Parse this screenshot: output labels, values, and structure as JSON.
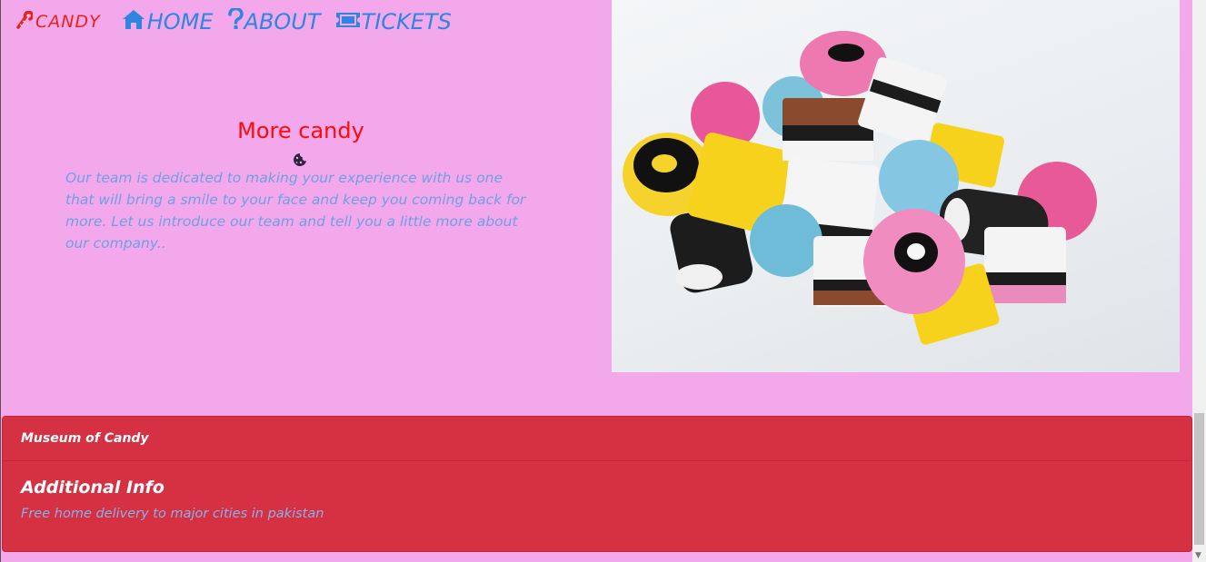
{
  "nav": {
    "brand": "CANDY",
    "links": [
      {
        "label": "HOME",
        "icon": "home-icon"
      },
      {
        "label": "ABOUT",
        "icon": "question-icon"
      },
      {
        "label": "TICKETS",
        "icon": "ticket-icon"
      }
    ]
  },
  "hero": {
    "title": "More candy",
    "icon": "cookie-icon",
    "text": "Our team is dedicated to making your experience with us one that will bring a smile to your face and keep you coming back for more. Let us introduce our team and tell you a little more about our company.."
  },
  "image": {
    "subject": "assorted liquorice allsorts candy"
  },
  "footer": {
    "header": "Museum of Candy",
    "title": "Additional Info",
    "text": "Free home delivery to major cities in pakistan"
  },
  "colors": {
    "background": "#f3a8ec",
    "brand": "#e8231c",
    "nav_link": "#2f86e0",
    "hero_title": "#ff0a0a",
    "hero_text": "#6fa0e5",
    "footer_bg": "#d63043"
  }
}
